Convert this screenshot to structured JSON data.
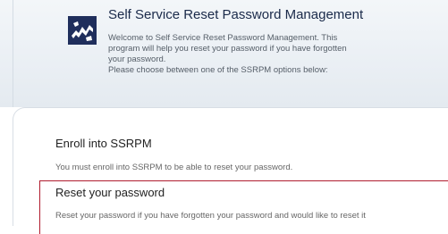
{
  "header": {
    "logo_icon": "ssrpm-logo-icon",
    "title": "Self Service Reset Password Management",
    "description_lines": [
      "Welcome to Self Service Reset Password Management. This",
      "program will help you reset your password if you have forgotten",
      "your password.",
      "Please choose between one of the SSRPM options below:"
    ]
  },
  "options": {
    "enroll": {
      "heading": "Enroll into SSRPM",
      "description": "You must enroll into SSRPM to be able to reset your password."
    },
    "reset": {
      "heading": "Reset your password",
      "description": "Reset your password if you have forgotten your password and would like to reset it"
    }
  },
  "colors": {
    "accent_border": "#b01c2e",
    "logo_bg": "#1f2e5c"
  }
}
